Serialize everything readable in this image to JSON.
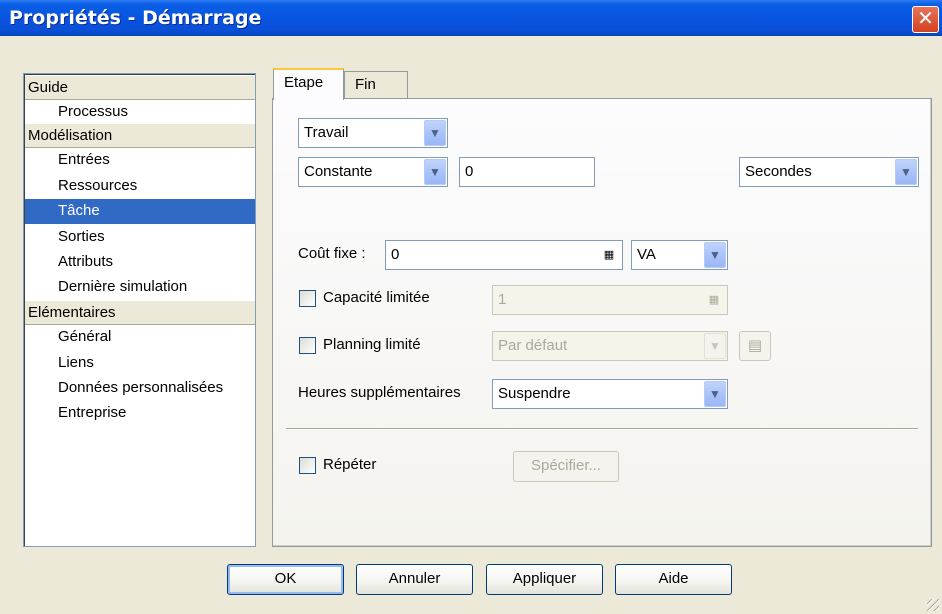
{
  "window": {
    "title": "Propriétés - Démarrage",
    "close_glyph": "✕"
  },
  "tree": {
    "items": [
      {
        "label": "Guide",
        "kind": "category"
      },
      {
        "label": "Processus",
        "kind": "item"
      },
      {
        "label": "Modélisation",
        "kind": "category"
      },
      {
        "label": "Entrées",
        "kind": "item"
      },
      {
        "label": "Ressources",
        "kind": "item"
      },
      {
        "label": "Tâche",
        "kind": "item",
        "selected": true
      },
      {
        "label": "Sorties",
        "kind": "item"
      },
      {
        "label": "Attributs",
        "kind": "item"
      },
      {
        "label": "Dernière simulation",
        "kind": "item"
      },
      {
        "label": "Elémentaires",
        "kind": "category"
      },
      {
        "label": "Général",
        "kind": "item"
      },
      {
        "label": "Liens",
        "kind": "item"
      },
      {
        "label": "Données personnalisées",
        "kind": "item"
      },
      {
        "label": "Entreprise",
        "kind": "item"
      }
    ]
  },
  "tabs": [
    {
      "label": "Etape",
      "active": true
    },
    {
      "label": "Fin",
      "active": false
    }
  ],
  "form": {
    "type_select": "Travail",
    "duration_mode_select": "Constante",
    "duration_value": "0",
    "duration_unit_select": "Secondes",
    "fixed_cost_label": "Coût fixe :",
    "fixed_cost_value": "0",
    "fixed_cost_type_select": "VA",
    "limited_capacity_label": "Capacité limitée",
    "limited_capacity_value": "1",
    "limited_capacity_checked": false,
    "limited_planning_label": "Planning limité",
    "limited_planning_select": "Par défaut",
    "limited_planning_checked": false,
    "overtime_label": "Heures supplémentaires",
    "overtime_select": "Suspendre",
    "repeat_label": "Répéter",
    "repeat_checked": false,
    "specify_button": "Spécifier..."
  },
  "icons": {
    "dropdown": "chevron-down-icon",
    "calculator": "calculator-icon",
    "calendar_grid": "calendar-grid-icon"
  },
  "buttons": {
    "ok": "OK",
    "cancel": "Annuler",
    "apply": "Appliquer",
    "help": "Aide"
  },
  "colors": {
    "titlebar": "#0854e0",
    "selection": "#316ac5",
    "window_bg": "#ece9d8",
    "tab_highlight": "#ffc83c"
  }
}
